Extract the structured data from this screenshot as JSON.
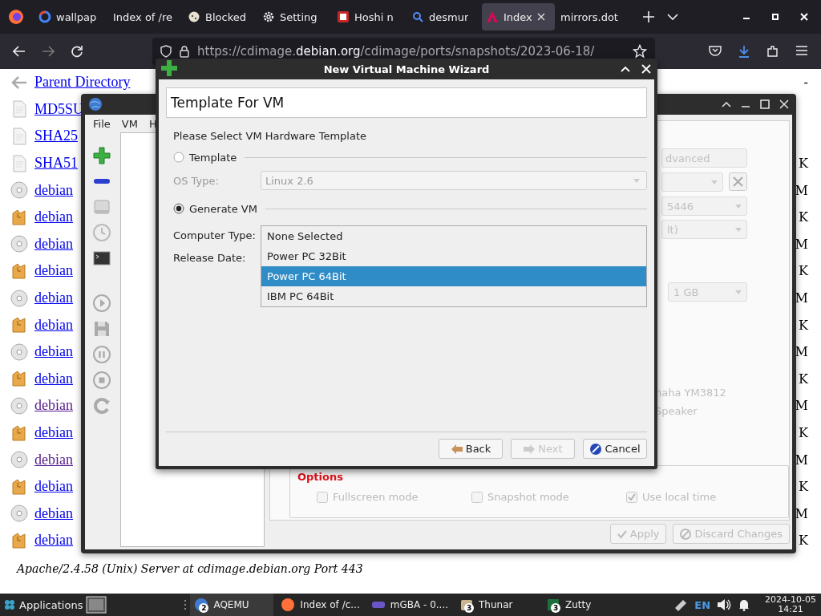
{
  "browser": {
    "tabs": [
      {
        "label": "wallpap",
        "selected": false
      },
      {
        "label": "Index of /re",
        "selected": false
      },
      {
        "label": "Blocked",
        "selected": false
      },
      {
        "label": "Setting",
        "selected": false
      },
      {
        "label": "Hoshi n",
        "selected": false
      },
      {
        "label": "desmur",
        "selected": false
      },
      {
        "label": "Index",
        "selected": true
      },
      {
        "label": "mirrors.dot",
        "selected": false
      }
    ],
    "url": {
      "prefix": "https://cdimage.",
      "domain": "debian.org",
      "path": "/cdimage/ports/snapshots/2023-06-18/"
    },
    "listing": [
      {
        "name": "Parent Directory",
        "kind": "back",
        "size": "-",
        "visited": false
      },
      {
        "name": "MD5SU",
        "kind": "text",
        "visited": false
      },
      {
        "name": "SHA25",
        "kind": "text",
        "visited": false
      },
      {
        "name": "SHA51",
        "kind": "text",
        "size": "K",
        "visited": false
      },
      {
        "name": "debian",
        "kind": "cd",
        "size": "M",
        "visited": false
      },
      {
        "name": "debian",
        "kind": "package",
        "size": "K",
        "visited": false
      },
      {
        "name": "debian",
        "kind": "cd",
        "size": "M",
        "visited": false
      },
      {
        "name": "debian",
        "kind": "package",
        "size": "K",
        "visited": false
      },
      {
        "name": "debian",
        "kind": "cd",
        "size": "M",
        "visited": false
      },
      {
        "name": "debian",
        "kind": "package",
        "size": "K",
        "visited": false
      },
      {
        "name": "debian",
        "kind": "cd",
        "size": "M",
        "visited": false
      },
      {
        "name": "debian",
        "kind": "package",
        "size": "K",
        "visited": false
      },
      {
        "name": "debian",
        "kind": "cd",
        "size": "M",
        "visited": true
      },
      {
        "name": "debian",
        "kind": "package",
        "size": "K",
        "visited": false
      },
      {
        "name": "debian",
        "kind": "cd",
        "size": "M",
        "visited": true
      },
      {
        "name": "debian",
        "kind": "package",
        "size": "K",
        "visited": false
      },
      {
        "name": "debian",
        "kind": "cd",
        "size": "M",
        "visited": false
      },
      {
        "name": "debian",
        "kind": "package",
        "size": "K",
        "visited": false
      }
    ],
    "footer": "Apache/2.4.58 (Unix) Server at cdimage.debian.org Port 443"
  },
  "aqemu": {
    "menu": [
      "File",
      "VM",
      "H"
    ],
    "fields": [
      {
        "kind": "field",
        "value": "dvanced"
      },
      {
        "kind": "tool-combo"
      },
      {
        "kind": "combo",
        "value": "5446"
      },
      {
        "kind": "combo",
        "value": "lt)"
      },
      {
        "kind": "spin",
        "value": "1 GB"
      },
      {
        "kind": "label",
        "value": "naha YM3812"
      },
      {
        "kind": "label",
        "value": "Speaker"
      }
    ],
    "options_title": "Options",
    "options": [
      {
        "label": "Fullscreen mode",
        "checked": false,
        "disabled": true
      },
      {
        "label": "Snapshot mode",
        "checked": false,
        "disabled": true
      },
      {
        "label": "Use local time",
        "checked": true,
        "disabled": true
      }
    ],
    "buttons": [
      {
        "label": "Apply",
        "disabled": true
      },
      {
        "label": "Discard Changes",
        "disabled": true
      }
    ]
  },
  "wizard": {
    "title": "New Virtual Machine Wizard",
    "header": "Template For VM",
    "prompt": "Please Select VM Hardware Template",
    "modes": [
      {
        "label": "Template",
        "selected": false
      },
      {
        "label": "Generate VM",
        "selected": true
      }
    ],
    "os_type": {
      "label": "OS Type:",
      "value": "Linux 2.6",
      "disabled": true
    },
    "computer_type": {
      "label": "Computer Type:",
      "options": [
        {
          "label": "None Selected",
          "selected": false
        },
        {
          "label": "Power PC 32Bit",
          "selected": false
        },
        {
          "label": "Power PC 64Bit",
          "selected": true
        },
        {
          "label": "IBM PC 64Bit",
          "selected": false
        }
      ]
    },
    "release_date": {
      "label": "Release Date:"
    },
    "buttons": [
      {
        "label": "Back",
        "disabled": false
      },
      {
        "label": "Next",
        "disabled": true
      },
      {
        "label": "Cancel",
        "disabled": false
      }
    ]
  },
  "taskbar": {
    "start": "Applications",
    "items": [
      {
        "label": "AQEMU",
        "badge": "2"
      },
      {
        "label": "Index of /c..."
      },
      {
        "label": "mGBA - 0...."
      },
      {
        "label": "Thunar",
        "badge": "3"
      },
      {
        "label": "Zutty",
        "badge": "3"
      }
    ],
    "language": "EN",
    "date": "2024-10-05",
    "time": "14:21"
  }
}
